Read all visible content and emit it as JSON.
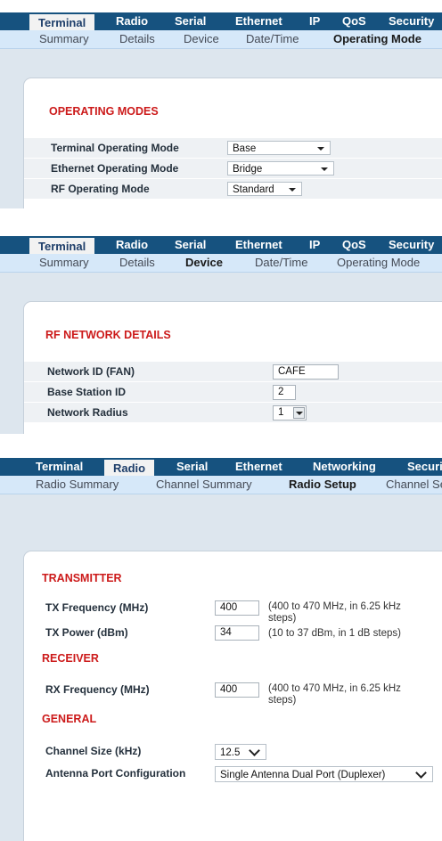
{
  "panel1": {
    "tabs": [
      "Terminal",
      "Radio",
      "Serial",
      "Ethernet",
      "IP",
      "QoS",
      "Security"
    ],
    "subtabs": [
      "Summary",
      "Details",
      "Device",
      "Date/Time",
      "Operating Mode"
    ],
    "section": "OPERATING MODES",
    "rows": [
      {
        "label": "Terminal Operating Mode",
        "value": "Base"
      },
      {
        "label": "Ethernet Operating Mode",
        "value": "Bridge"
      },
      {
        "label": "RF Operating Mode",
        "value": "Standard"
      }
    ]
  },
  "panel2": {
    "tabs": [
      "Terminal",
      "Radio",
      "Serial",
      "Ethernet",
      "IP",
      "QoS",
      "Security"
    ],
    "subtabs": [
      "Summary",
      "Details",
      "Device",
      "Date/Time",
      "Operating Mode"
    ],
    "section": "RF NETWORK DETAILS",
    "rows": [
      {
        "label": "Network ID (FAN)",
        "value": "CAFE"
      },
      {
        "label": "Base Station ID",
        "value": "2"
      },
      {
        "label": "Network Radius",
        "value": "1"
      }
    ]
  },
  "panel3": {
    "tabs": [
      "Terminal",
      "Radio",
      "Serial",
      "Ethernet",
      "Networking",
      "Security"
    ],
    "subtabs": [
      "Radio Summary",
      "Channel Summary",
      "Radio Setup",
      "Channel Setup"
    ],
    "transmitter_title": "TRANSMITTER",
    "tx_freq_label": "TX Frequency (MHz)",
    "tx_freq_value": "400",
    "tx_freq_hint1": "(400 to 470 MHz, in 6.25 kHz",
    "tx_freq_hint2": "steps)",
    "tx_power_label": "TX Power (dBm)",
    "tx_power_value": "34",
    "tx_power_hint": "(10 to 37 dBm, in 1 dB steps)",
    "receiver_title": "RECEIVER",
    "rx_freq_label": "RX Frequency (MHz)",
    "rx_freq_value": "400",
    "rx_freq_hint1": "(400 to 470 MHz, in 6.25 kHz",
    "rx_freq_hint2": "steps)",
    "general_title": "GENERAL",
    "channel_size_label": "Channel Size (kHz)",
    "channel_size_value": "12.5",
    "antenna_label": "Antenna Port Configuration",
    "antenna_value": "Single Antenna Dual Port (Duplexer)"
  }
}
